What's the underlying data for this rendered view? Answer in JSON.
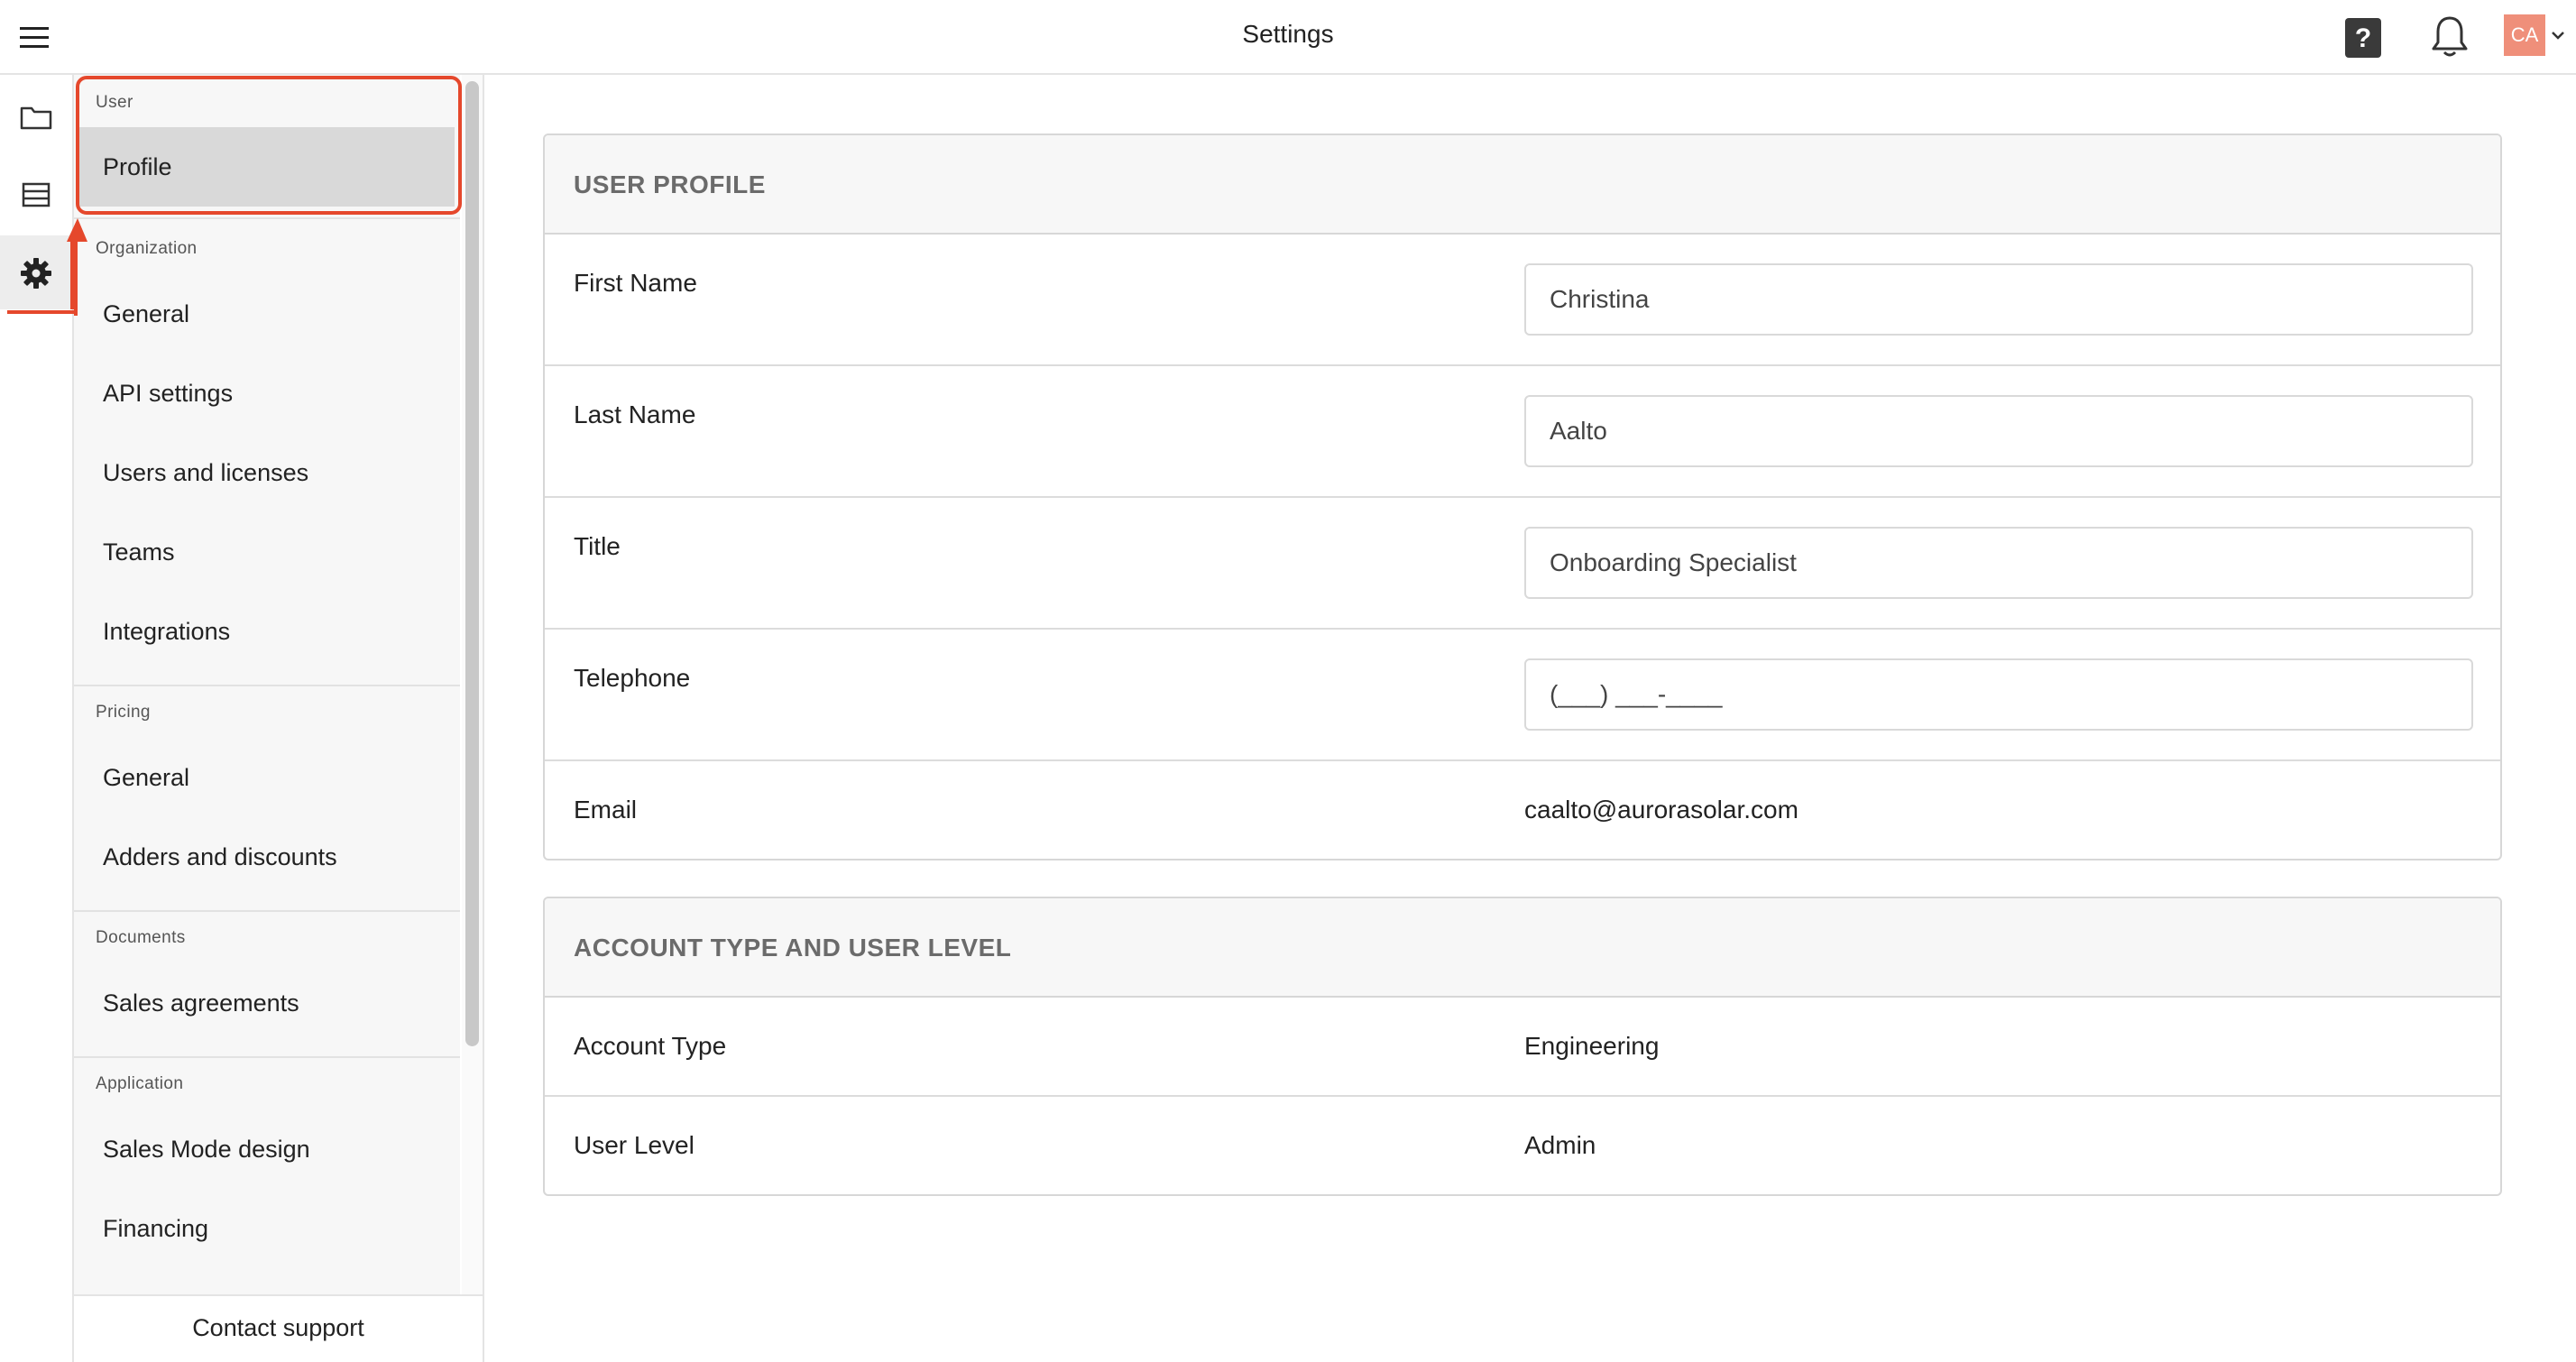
{
  "header": {
    "title": "Settings",
    "help_label": "?",
    "avatar_initials": "CA"
  },
  "rail": {
    "items": [
      {
        "icon": "folder-icon"
      },
      {
        "icon": "list-icon"
      },
      {
        "icon": "gear-icon",
        "active": true
      }
    ]
  },
  "sidebar": {
    "sections": [
      {
        "title": "User",
        "items": [
          {
            "label": "Profile",
            "selected": true
          }
        ]
      },
      {
        "title": "Organization",
        "items": [
          {
            "label": "General"
          },
          {
            "label": "API settings"
          },
          {
            "label": "Users and licenses"
          },
          {
            "label": "Teams"
          },
          {
            "label": "Integrations"
          }
        ]
      },
      {
        "title": "Pricing",
        "items": [
          {
            "label": "General"
          },
          {
            "label": "Adders and discounts"
          }
        ]
      },
      {
        "title": "Documents",
        "items": [
          {
            "label": "Sales agreements"
          }
        ]
      },
      {
        "title": "Application",
        "items": [
          {
            "label": "Sales Mode design"
          },
          {
            "label": "Financing"
          }
        ]
      }
    ],
    "footer_label": "Contact support"
  },
  "user_profile": {
    "heading": "USER PROFILE",
    "first_name": {
      "label": "First Name",
      "value": "Christina"
    },
    "last_name": {
      "label": "Last Name",
      "value": "Aalto"
    },
    "title": {
      "label": "Title",
      "value": "Onboarding Specialist"
    },
    "telephone": {
      "label": "Telephone",
      "value": "(___) ___-____"
    },
    "email": {
      "label": "Email",
      "value": "caalto@aurorasolar.com"
    }
  },
  "account": {
    "heading": "ACCOUNT TYPE AND USER LEVEL",
    "account_type": {
      "label": "Account Type",
      "value": "Engineering"
    },
    "user_level": {
      "label": "User Level",
      "value": "Admin"
    }
  },
  "colors": {
    "accent": "#e5482c",
    "avatar": "#ef8f7a",
    "selected_item": "#d9d9d9"
  }
}
